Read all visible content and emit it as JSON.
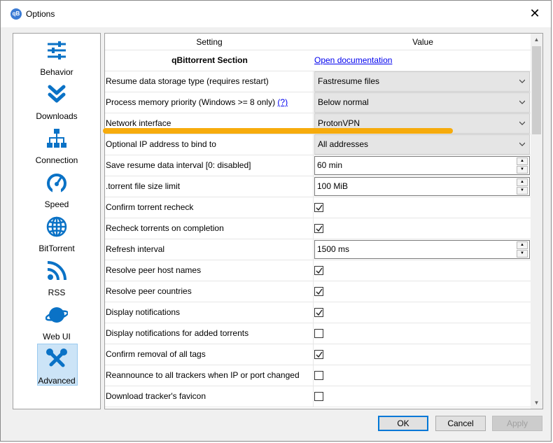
{
  "window": {
    "title": "Options",
    "app_icon": "qB"
  },
  "sidebar": {
    "items": [
      {
        "label": "Behavior",
        "icon": "sliders-icon"
      },
      {
        "label": "Downloads",
        "icon": "chevrons-down-icon"
      },
      {
        "label": "Connection",
        "icon": "network-icon"
      },
      {
        "label": "Speed",
        "icon": "speedometer-icon"
      },
      {
        "label": "BitTorrent",
        "icon": "globe-icon"
      },
      {
        "label": "RSS",
        "icon": "rss-icon"
      },
      {
        "label": "Web UI",
        "icon": "planet-icon"
      },
      {
        "label": "Advanced",
        "icon": "tools-icon",
        "selected": true
      }
    ]
  },
  "table": {
    "headers": {
      "setting": "Setting",
      "value": "Value"
    },
    "section": {
      "label": "qBittorrent Section",
      "link": "Open documentation"
    },
    "rows": [
      {
        "setting": "Resume data storage type (requires restart)",
        "type": "combo",
        "value": "Fastresume files"
      },
      {
        "setting": "Process memory priority (Windows >= 8 only)",
        "help": "(?)",
        "type": "combo",
        "value": "Below normal"
      },
      {
        "setting": "Network interface",
        "type": "combo",
        "value": "ProtonVPN"
      },
      {
        "setting": "Optional IP address to bind to",
        "type": "combo",
        "value": "All addresses"
      },
      {
        "setting": "Save resume data interval [0: disabled]",
        "type": "spin",
        "value": "60 min"
      },
      {
        "setting": ".torrent file size limit",
        "type": "spin",
        "value": "100 MiB"
      },
      {
        "setting": "Confirm torrent recheck",
        "type": "check",
        "checked": true
      },
      {
        "setting": "Recheck torrents on completion",
        "type": "check",
        "checked": true
      },
      {
        "setting": "Refresh interval",
        "type": "spin",
        "value": "1500 ms"
      },
      {
        "setting": "Resolve peer host names",
        "type": "check",
        "checked": true
      },
      {
        "setting": "Resolve peer countries",
        "type": "check",
        "checked": true
      },
      {
        "setting": "Display notifications",
        "type": "check",
        "checked": true
      },
      {
        "setting": "Display notifications for added torrents",
        "type": "check",
        "checked": false
      },
      {
        "setting": "Confirm removal of all tags",
        "type": "check",
        "checked": true
      },
      {
        "setting": "Reannounce to all trackers when IP or port changed",
        "type": "check",
        "checked": false
      },
      {
        "setting": "Download tracker's favicon",
        "type": "check",
        "checked": false
      }
    ]
  },
  "buttons": {
    "ok": "OK",
    "cancel": "Cancel",
    "apply": "Apply"
  },
  "colors": {
    "accent": "#0078d7",
    "icon_blue": "#0a72c6",
    "highlight": "#f7a800",
    "selection": "#cce4f7"
  }
}
